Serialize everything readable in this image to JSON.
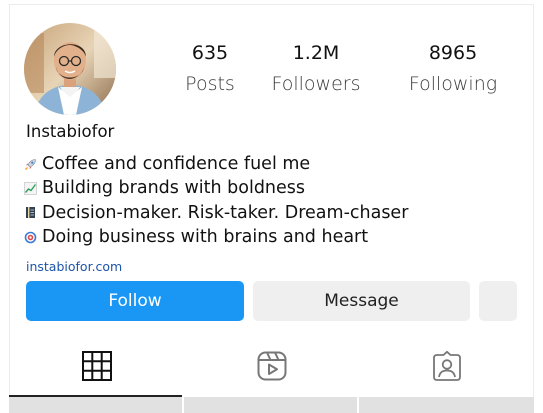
{
  "profile": {
    "username": "Instabiofor",
    "website": "instabiofor.com",
    "stats": [
      {
        "value": "635",
        "label": "Posts"
      },
      {
        "value": "1.2M",
        "label": "Followers"
      },
      {
        "value": "8965",
        "label": "Following"
      }
    ],
    "bio": [
      {
        "icon": "rocket-icon",
        "text": "Coffee and confidence fuel me"
      },
      {
        "icon": "chart-increasing-icon",
        "text": "Building brands with boldness"
      },
      {
        "icon": "ledger-icon",
        "text": "Decision-maker. Risk-taker. Dream-chaser"
      },
      {
        "icon": "target-icon",
        "text": "Doing business with brains and heart"
      }
    ]
  },
  "actions": {
    "follow_label": "Follow",
    "message_label": "Message"
  },
  "tabs": [
    {
      "icon": "grid-icon",
      "active": true
    },
    {
      "icon": "reels-icon",
      "active": false
    },
    {
      "icon": "tagged-icon",
      "active": false
    }
  ],
  "colors": {
    "follow_button": "#1a97f5",
    "secondary_button": "#efefef",
    "link": "#1d55a8",
    "active_tab_underline": "#222222"
  }
}
